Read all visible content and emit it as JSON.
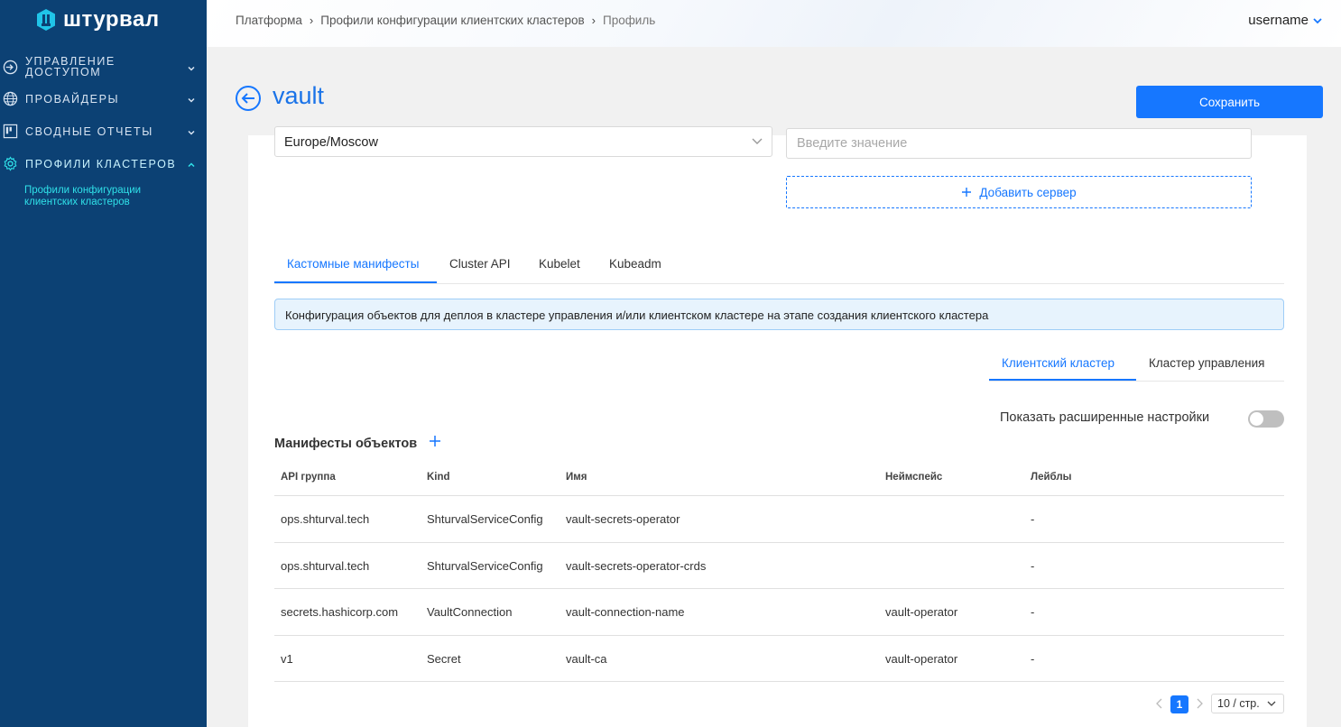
{
  "sidebar": {
    "logo_text": "штурвал",
    "items": [
      {
        "label_line1": "УПРАВЛЕНИЕ",
        "label_line2": "ДОСТУПОМ",
        "icon": "login-icon"
      },
      {
        "label": "ПРОВАЙДЕРЫ",
        "icon": "globe-icon"
      },
      {
        "label": "СВОДНЫЕ ОТЧЕТЫ",
        "icon": "board-icon"
      },
      {
        "label": "ПРОФИЛИ КЛАСТЕРОВ",
        "icon": "gear-icon"
      }
    ],
    "sub_item": "Профили конфигурации клиентских кластеров"
  },
  "header": {
    "breadcrumb": [
      "Платформа",
      "Профили конфигурации клиентских кластеров",
      "Профиль"
    ],
    "username": "username"
  },
  "page": {
    "title": "vault",
    "save_label": "Сохранить"
  },
  "form": {
    "timezone_value": "Europe/Moscow",
    "server_placeholder": "Введите значение",
    "add_server_label": "Добавить сервер"
  },
  "tabs_main": [
    "Кастомные манифесты",
    "Cluster API",
    "Kubelet",
    "Kubeadm"
  ],
  "info_text": "Конфигурация объектов для деплоя в кластере управления и/или клиентском кластере на этапе создания клиентского кластера",
  "tabs_sub": [
    "Клиентский кластер",
    "Кластер управления"
  ],
  "advanced_label": "Показать расширенные настройки",
  "section_title": "Манифесты объектов",
  "table": {
    "columns": [
      "API группа",
      "Kind",
      "Имя",
      "Неймспейс",
      "Лейблы"
    ],
    "rows": [
      [
        "ops.shturval.tech",
        "ShturvalServiceConfig",
        "vault-secrets-operator",
        "",
        "-"
      ],
      [
        "ops.shturval.tech",
        "ShturvalServiceConfig",
        "vault-secrets-operator-crds",
        "",
        "-"
      ],
      [
        "secrets.hashicorp.com",
        "VaultConnection",
        "vault-connection-name",
        "vault-operator",
        "-"
      ],
      [
        "v1",
        "Secret",
        "vault-ca",
        "vault-operator",
        "-"
      ]
    ]
  },
  "pagination": {
    "current_page": "1",
    "page_size": "10 / стр."
  },
  "colors": {
    "sidebar_bg": "#0c4174",
    "accent": "#1677ff",
    "sub_item": "#2fe0e8"
  }
}
